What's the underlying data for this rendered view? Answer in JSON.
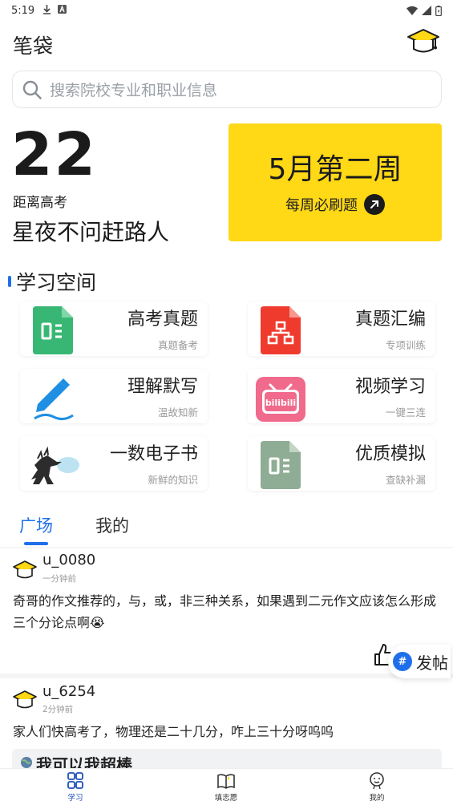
{
  "status_bar": {
    "time": "5:19"
  },
  "header": {
    "title": "笔袋"
  },
  "search": {
    "placeholder": "搜索院校专业和职业信息"
  },
  "countdown": {
    "days": "22",
    "label": "距离高考",
    "motto": "星夜不问赶路人"
  },
  "weekly_card": {
    "title": "5月第二周",
    "subtitle": "每周必刷题"
  },
  "section": {
    "title": "学习空间"
  },
  "tiles": [
    {
      "title": "高考真题",
      "subtitle": "真题备考",
      "icon": "green-doc-icon"
    },
    {
      "title": "真题汇编",
      "subtitle": "专项训练",
      "icon": "red-org-doc-icon"
    },
    {
      "title": "理解默写",
      "subtitle": "温故知新",
      "icon": "pen-icon"
    },
    {
      "title": "视频学习",
      "subtitle": "一键三连",
      "icon": "bilibili-icon"
    },
    {
      "title": "一数电子书",
      "subtitle": "新鲜的知识",
      "icon": "godzilla-icon"
    },
    {
      "title": "优质模拟",
      "subtitle": "查缺补漏",
      "icon": "grey-doc-icon"
    }
  ],
  "tabs": [
    {
      "label": "广场"
    },
    {
      "label": "我的"
    }
  ],
  "posts": [
    {
      "user": "u_0080",
      "time": "一分钟前",
      "content": "奇哥的作文推荐的，与，或，非三种关系，如果遇到二元作文应该怎么形成三个分论点啊😭"
    },
    {
      "user": "u_6254",
      "time": "2分钟前",
      "content": "家人们快高考了，物理还是二十几分，咋上三十分呀呜呜"
    }
  ],
  "chip": {
    "text": "我可以我超棒"
  },
  "fab": {
    "label": "发帖"
  },
  "bottom_nav": [
    {
      "label": "学习"
    },
    {
      "label": "填志愿"
    },
    {
      "label": "我的"
    }
  ],
  "colors": {
    "accent": "#1f6feb",
    "card_yellow": "#ffd816"
  }
}
